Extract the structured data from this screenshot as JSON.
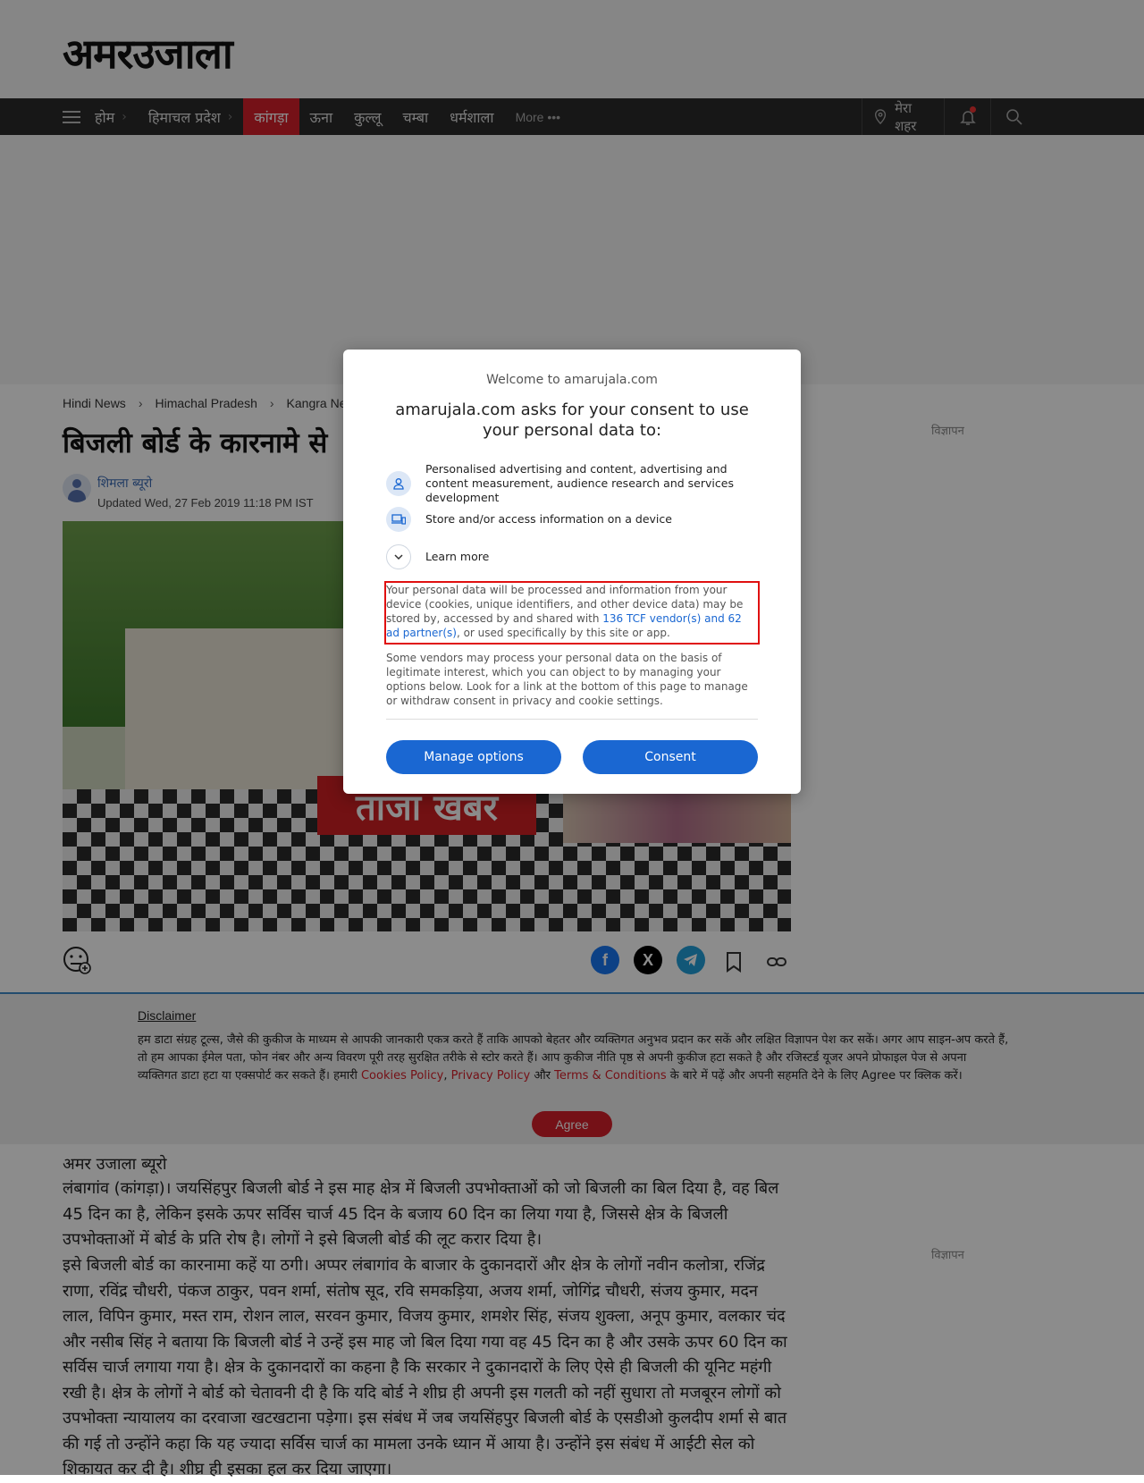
{
  "header": {
    "logo": "अमरउजाला",
    "nav": [
      {
        "label": "होम",
        "sep": "›"
      },
      {
        "label": "हिमाचल प्रदेश",
        "sep": "›"
      },
      {
        "label": "कांगड़ा"
      },
      {
        "label": "ऊना"
      },
      {
        "label": "कुल्लू"
      },
      {
        "label": "चम्बा"
      },
      {
        "label": "धर्मशाला"
      }
    ],
    "more": "More •••",
    "my_city": "मेरा शहर"
  },
  "breadcrumb": [
    "Hindi News",
    "Himachal Pradesh",
    "Kangra New"
  ],
  "breadcrumb_sep": "›",
  "ad_label": "विज्ञापन",
  "article": {
    "headline": "बिजली बोर्ड के कारनामे से",
    "author": "शिमला ब्यूरो",
    "updated": "Updated Wed, 27 Feb 2019 11:18 PM IST",
    "image_banner": "ताजा खबर",
    "byline": "अमर उजाला ब्यूरो",
    "p1": "लंबागांव (कांगड़ा)। जयसिंहपुर बिजली बोर्ड ने इस माह क्षेत्र में बिजली उपभोक्ताओं को जो बिजली का बिल दिया है, वह बिल 45 दिन का है, लेकिन इसके ऊपर सर्विस चार्ज 45 दिन के बजाय 60 दिन का लिया गया है, जिससे क्षेत्र के बिजली उपभोक्ताओं में बोर्ड के प्रति रोष है। लोगों ने इसे बिजली बोर्ड की लूट करार दिया है।",
    "p2": "इसे बिजली बोर्ड का कारनामा कहें या ठगी। अप्पर लंबागांव के बाजार के दुकानदारों और क्षेत्र के लोगों नवीन कलोत्रा, रजिंद्र राणा, रविंद्र चौधरी, पंकज ठाकुर, पवन शर्मा, संतोष सूद, रवि समकड़िया, अजय शर्मा, जोगिंद्र चौधरी, संजय कुमार, मदन लाल, विपिन कुमार, मस्त राम, रोशन लाल, सरवन कुमार, विजय कुमार, शमशेर सिंह, संजय शुक्ला, अनूप कुमार, वलकार चंद और नसीब सिंह ने बताया कि बिजली बोर्ड ने उन्हें इस माह जो बिल दिया गया वह 45 दिन का है और उसके ऊपर 60 दिन का सर्विस चार्ज लगाया गया है। क्षेत्र के दुकानदारों का कहना है कि सरकार ने दुकानदारों के लिए ऐसे ही बिजली की यूनिट महंगी रखी है। क्षेत्र के लोगों ने बोर्ड को चेतावनी दी है कि यदि बोर्ड ने शीघ्र ही अपनी इस गलती को नहीं सुधारा तो मजबूरन लोगों को उपभोक्ता न्यायालय का दरवाजा खटखटाना पड़ेगा। इस संबंध में जब जयसिंहपुर बिजली बोर्ड के एसडीओ कुलदीप शर्मा से बात की गई तो उन्होंने कहा कि यह ज्यादा सर्विस चार्ज का मामला उनके ध्यान में आया है। उन्होंने इस संबंध में आईटी सेल को शिकायत कर दी है। शीघ्र ही इसका हल कर दिया जाएगा।"
  },
  "disclaimer": {
    "title": "Disclaimer",
    "text_before": "हम डाटा संग्रह टूल्स, जैसे की कुकीज के माध्यम से आपकी जानकारी एकत्र करते हैं ताकि आपको बेहतर और व्यक्तिगत अनुभव प्रदान कर सकें और लक्षित विज्ञापन पेश कर सकें। अगर आप साइन-अप करते हैं, तो हम आपका ईमेल पता, फोन नंबर और अन्य विवरण पूरी तरह सुरक्षित तरीके से स्टोर करते हैं। आप कुकीज नीति पृष्ठ से अपनी कुकीज हटा सकते है और रजिस्टर्ड यूजर अपने प्रोफाइल पेज से अपना व्यक्तिगत डाटा हटा या एक्सपोर्ट कर सकते हैं। हमारी ",
    "cookies_link": "Cookies Policy",
    "comma": ", ",
    "privacy_link": "Privacy Policy",
    "and": " और ",
    "terms_link": "Terms & Conditions",
    "text_after": " के बारे में पढ़ें और अपनी सहमति देने के लिए Agree पर क्लिक करें।",
    "agree": "Agree"
  },
  "consent": {
    "welcome": "Welcome to amarujala.com",
    "title": "amarujala.com asks for your consent to use your personal data to:",
    "purpose1": "Personalised advertising and content, advertising and content measurement, audience research and services development",
    "purpose2": "Store and/or access information on a device",
    "learn_more": "Learn more",
    "info1_before": "Your personal data will be processed and information from your device (cookies, unique identifiers, and other device data) may be stored by, accessed by and shared with ",
    "info1_link": "136 TCF vendor(s) and 62 ad partner(s)",
    "info1_after": ", or used specifically by this site or app.",
    "info2": "Some vendors may process your personal data on the basis of legitimate interest, which you can object to by managing your options below. Look for a link at the bottom of this page to manage or withdraw consent in privacy and cookie settings.",
    "manage": "Manage options",
    "consent": "Consent"
  },
  "colors": {
    "brand_red": "#d6202a",
    "consent_blue": "#1a67d2"
  }
}
